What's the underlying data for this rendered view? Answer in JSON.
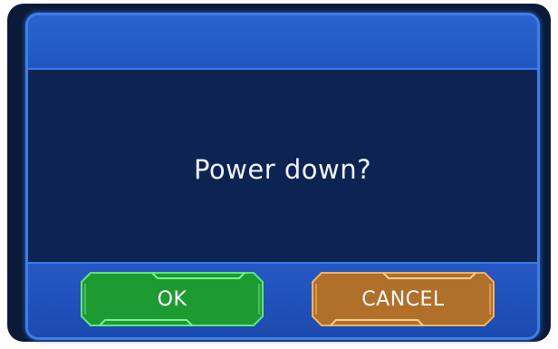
{
  "dialog": {
    "title": "",
    "message": "Power down?",
    "buttons": {
      "ok_label": "OK",
      "cancel_label": "CANCEL"
    }
  },
  "colors": {
    "frame_dark": "#0c1a3a",
    "border_blue": "#3d7fe6",
    "title_bar": "#2a63cf",
    "content_bg": "#0d2453",
    "ok_green": "#23a83a",
    "cancel_orange": "#b8742a"
  }
}
